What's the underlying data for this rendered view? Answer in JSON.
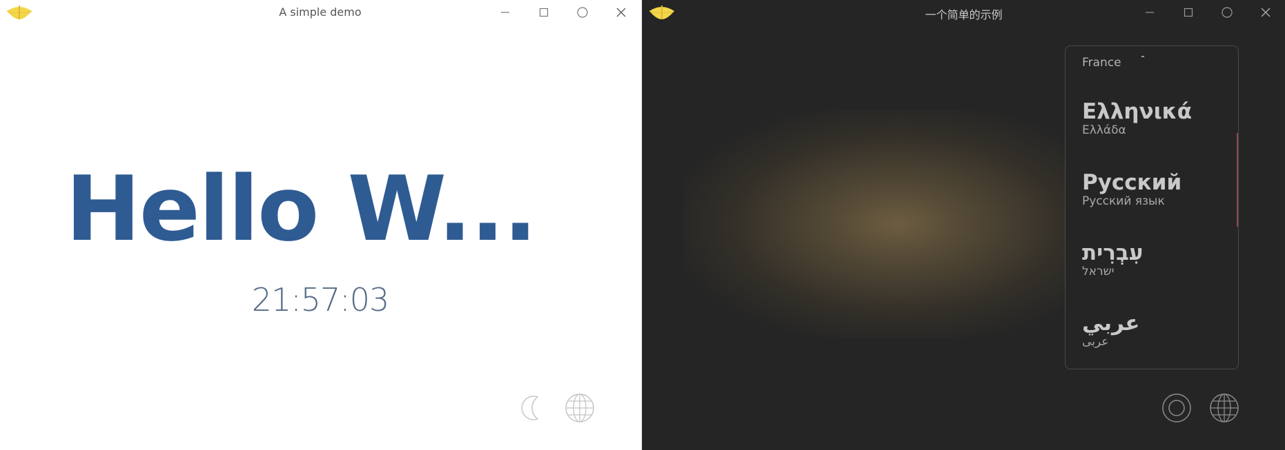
{
  "left_window": {
    "title": "A simple demo",
    "hello_text": "Hello W...",
    "clock": "21:57:03",
    "icons": [
      "app-logo",
      "minimize-icon",
      "maximize-icon",
      "circle-icon",
      "close-icon",
      "moon-icon",
      "globe-icon"
    ]
  },
  "right_window": {
    "title": "一个简单的示例",
    "icons": [
      "app-logo",
      "minimize-icon",
      "maximize-icon",
      "circle-icon",
      "close-icon",
      "ring-icon",
      "globe-icon"
    ],
    "language_list": {
      "partial_top_region": "France",
      "items": [
        {
          "name": "Ελληνικά",
          "region": "Ελλάδα"
        },
        {
          "name": "Русский",
          "region": "Русский язык"
        },
        {
          "name": "עִבְרִית",
          "region": "ישראל"
        },
        {
          "name": "عربي",
          "region": "عربى"
        }
      ]
    }
  },
  "colors": {
    "hello_blue": "#2f5b93",
    "logo_yellow": "#f2d64b",
    "dark_bg": "#252525",
    "glow": "#706042"
  }
}
